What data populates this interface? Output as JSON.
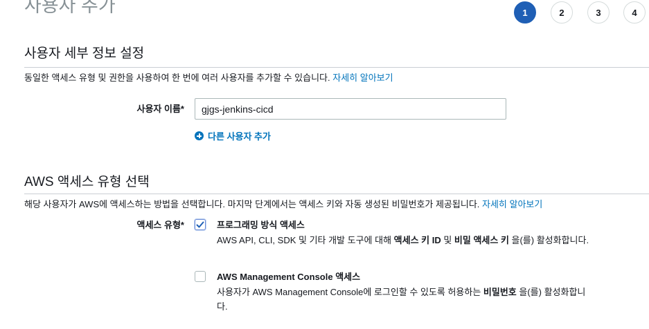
{
  "page": {
    "title": "사용자 추가"
  },
  "steps": [
    "1",
    "2",
    "3",
    "4"
  ],
  "details": {
    "title": "사용자 세부 정보 설정",
    "description": "동일한 액세스 유형 및 권한을 사용하여 한 번에 여러 사용자를 추가할 수 있습니다.",
    "learn_more": "자세히 알아보기",
    "username_label": "사용자 이름*",
    "username_value": "gjgs-jenkins-cicd",
    "add_user": "다른 사용자 추가"
  },
  "access": {
    "title": "AWS 액세스 유형 선택",
    "description": "해당 사용자가 AWS에 액세스하는 방법을 선택합니다. 마지막 단계에서는 액세스 키와 자동 생성된 비밀번호가 제공됩니다.",
    "learn_more": "자세히 알아보기",
    "type_label": "액세스 유형*",
    "programmatic": {
      "title": "프로그래밍 방식 액세스",
      "desc_pre": "AWS API, CLI, SDK 및 기타 개발 도구에 대해 ",
      "desc_bold1": "액세스 키 ID",
      "desc_mid": " 및 ",
      "desc_bold2": "비밀 액세스 키",
      "desc_post": " 을(를) 활성화합니다.",
      "checked": true
    },
    "console": {
      "title": "AWS Management Console 액세스",
      "desc_pre": "사용자가 AWS Management Console에 로그인할 수 있도록 허용하는 ",
      "desc_bold": "비밀번호",
      "desc_post": " 을(를) 활성화합니다.",
      "checked": false
    }
  },
  "colors": {
    "accent": "#1f5fb5",
    "link": "#0073bb",
    "muted_title": "#879196"
  }
}
